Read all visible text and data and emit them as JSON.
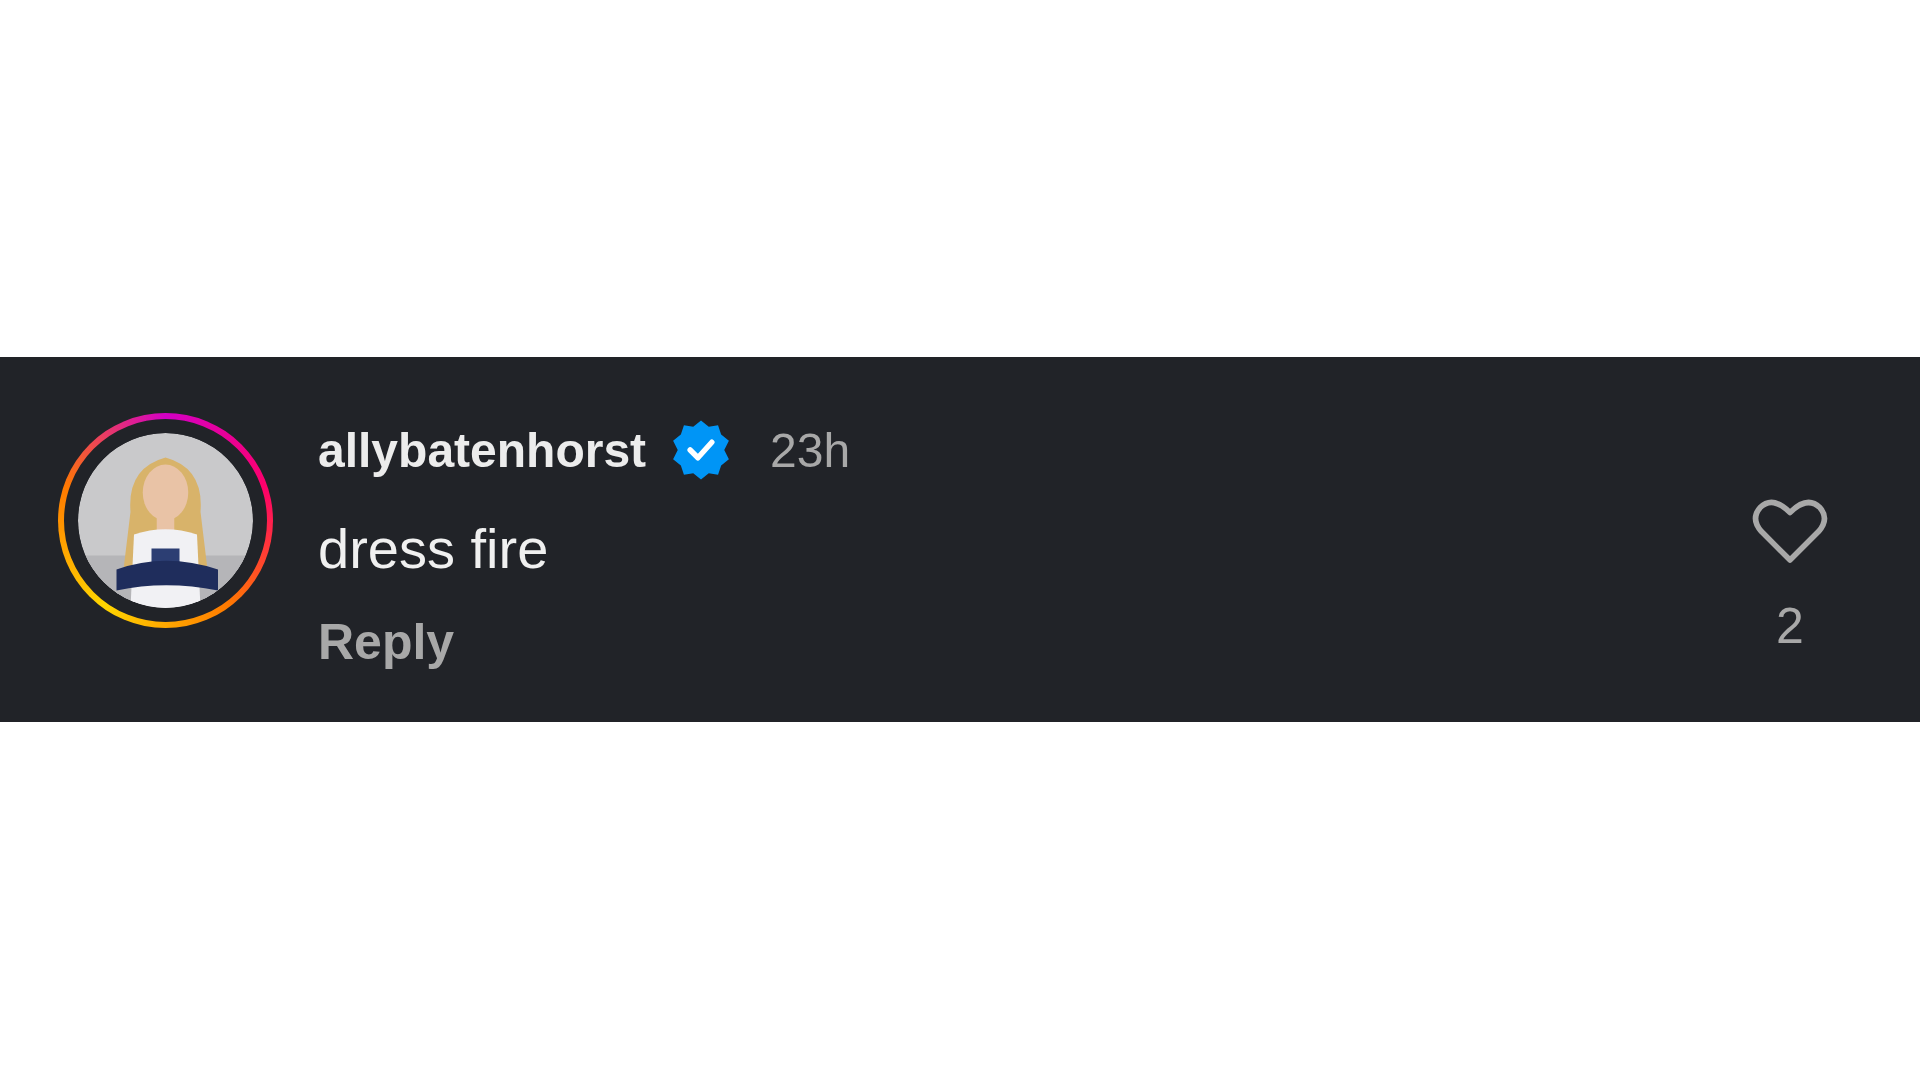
{
  "comment": {
    "avatar": {
      "kind": "picture",
      "story_ring": true
    },
    "username": "allybatenhorst",
    "verified": true,
    "time": "23h",
    "text": "dress fire",
    "reply": "Reply",
    "liked": false,
    "likes": "2"
  }
}
